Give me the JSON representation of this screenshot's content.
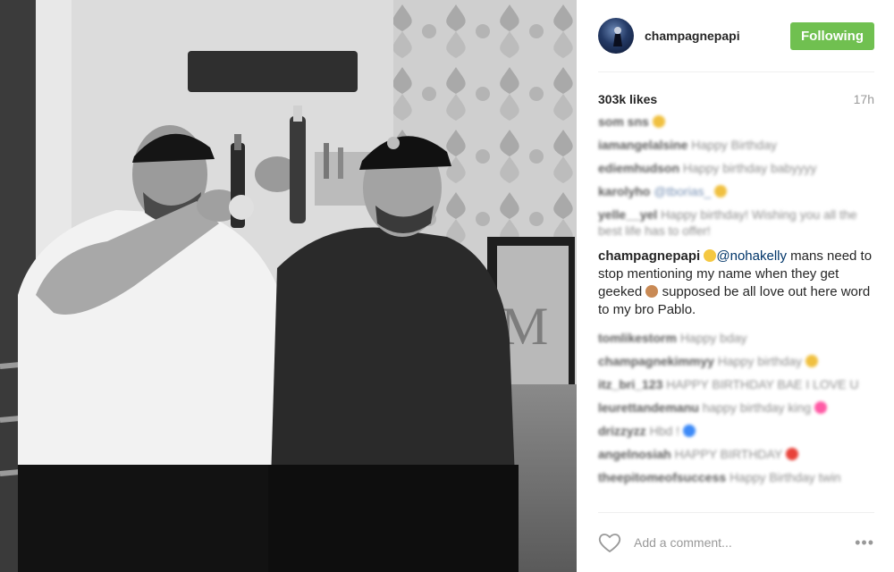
{
  "header": {
    "username": "champagnepapi",
    "follow_label": "Following",
    "avatar_icon": "avatar-image"
  },
  "meta": {
    "likes": "303k likes",
    "time_ago": "17h"
  },
  "comments": [
    {
      "user": "som sns",
      "text": "",
      "emoji": "#f0c040"
    },
    {
      "user": "iamangelalsine",
      "text": "Happy Birthday"
    },
    {
      "user": "ediemhudson",
      "text": "Happy birthday babyyyy"
    },
    {
      "user": "karolyho",
      "mention": "@tborias_",
      "emoji": "#f0c040"
    },
    {
      "user": "yelle__yel",
      "text": "Happy birthday! Wishing you all the best life has to offer!"
    }
  ],
  "caption": {
    "user": "champagnepapi",
    "mention": "@nohakelly",
    "text_a": "mans need to stop mentioning my name when they get geeked",
    "text_b": "supposed be all love out here word to my bro Pablo."
  },
  "comments_after": [
    {
      "user": "tomlikestorm",
      "text": "Happy bday"
    },
    {
      "user": "champagnekimmyy",
      "text": "Happy birthday",
      "emoji": "#f0c040"
    },
    {
      "user": "itz_bri_123",
      "text": "HAPPY BIRTHDAY BAE I LOVE U"
    },
    {
      "user": "leurettandemanu",
      "text": "happy birthday king",
      "emoji": "#ff5aa5"
    },
    {
      "user": "drizzyzz",
      "text": "Hbd !",
      "emoji": "#3d8af7"
    },
    {
      "user": "angelnosiah",
      "text": "HAPPY BIRTHDAY",
      "emoji": "#e8423a"
    },
    {
      "user": "theepitomeofsuccess",
      "text": "Happy Birthday twin"
    }
  ],
  "footer": {
    "comment_placeholder": "Add a comment...",
    "more_label": "•••",
    "heart_icon": "heart-outline-icon"
  }
}
